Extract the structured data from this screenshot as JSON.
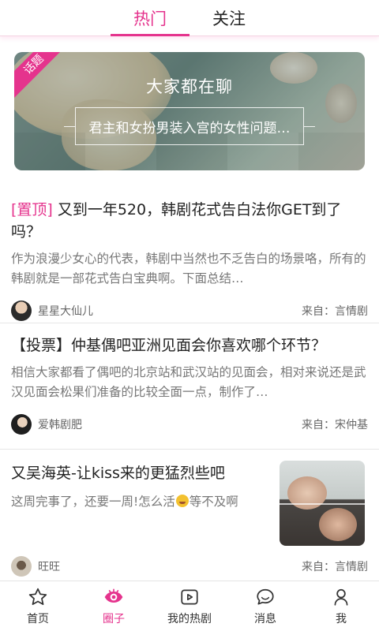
{
  "colors": {
    "accent": "#e5338d",
    "text_primary": "#222222",
    "text_secondary": "#777777"
  },
  "tabs": [
    {
      "label": "热门",
      "active": true
    },
    {
      "label": "关注",
      "active": false
    }
  ],
  "banner": {
    "tag": "话题",
    "title": "大家都在聊",
    "subtitle": "君主和女扮男装入宫的女性问题…"
  },
  "posts": [
    {
      "pinned_tag": "[置顶]",
      "title": "又到一年520，韩剧花式告白法你GET到了吗？",
      "excerpt": "作为浪漫少女心的代表，韩剧中当然也不乏告白的场景咯，所有的韩剧就是一部花式告白宝典啊。下面总结…",
      "author": "星星大仙儿",
      "source": "来自：言情剧"
    },
    {
      "title": "【投票】仲基偶吧亚洲见面会你喜欢哪个环节？",
      "excerpt": "相信大家都看了偶吧的北京站和武汉站的见面会，相对来说还是武汉见面会松果们准备的比较全面一点，制作了…",
      "author": "爱韩剧肥",
      "source": "来自：宋仲基"
    },
    {
      "title": "又吴海英-让kiss来的更猛烈些吧",
      "excerpt_before": "这周完事了，还要一周!怎么活",
      "excerpt_after": "等不及啊",
      "emoji_icon": "grin-emoji-icon",
      "author": "旺旺",
      "source": "来自：言情剧"
    }
  ],
  "bottom_nav": [
    {
      "label": "首页",
      "icon": "star-icon",
      "active": false
    },
    {
      "label": "圈子",
      "icon": "eye-icon",
      "active": true
    },
    {
      "label": "我的热剧",
      "icon": "play-icon",
      "active": false
    },
    {
      "label": "消息",
      "icon": "chat-bubble-icon",
      "active": false
    },
    {
      "label": "我",
      "icon": "person-icon",
      "active": false
    }
  ]
}
